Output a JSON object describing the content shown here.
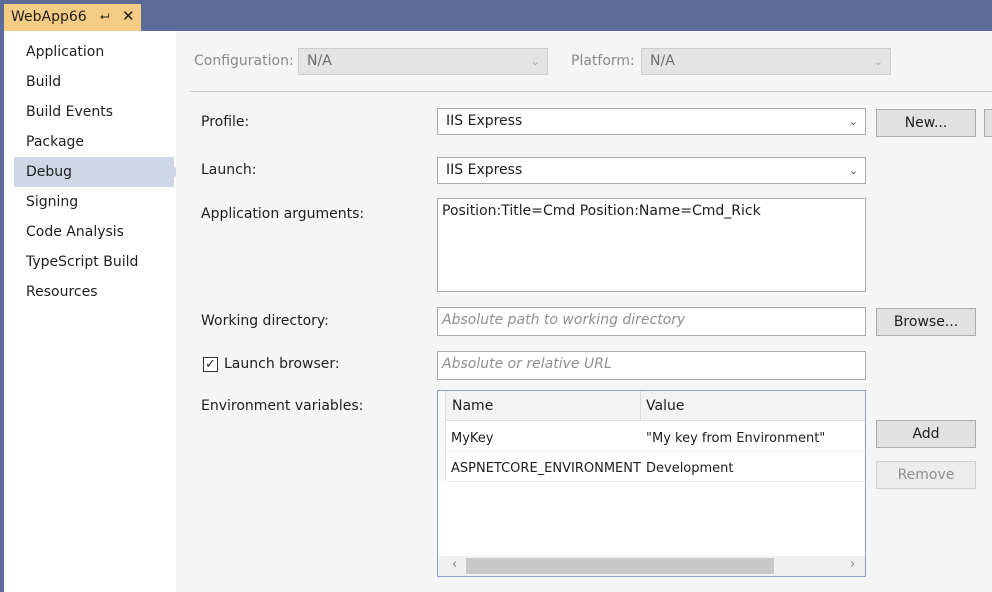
{
  "tab": {
    "title": "WebApp66",
    "pin_glyph": "⮠",
    "close_glyph": "✕"
  },
  "sidebar": {
    "items": [
      {
        "label": "Application"
      },
      {
        "label": "Build"
      },
      {
        "label": "Build Events"
      },
      {
        "label": "Package"
      },
      {
        "label": "Debug",
        "active": true
      },
      {
        "label": "Signing"
      },
      {
        "label": "Code Analysis"
      },
      {
        "label": "TypeScript Build"
      },
      {
        "label": "Resources"
      }
    ]
  },
  "toolbar": {
    "configuration_label": "Configuration:",
    "configuration_value": "N/A",
    "platform_label": "Platform:",
    "platform_value": "N/A"
  },
  "form": {
    "profile_label": "Profile:",
    "profile_value": "IIS Express",
    "new_button": "New...",
    "launch_label": "Launch:",
    "launch_value": "IIS Express",
    "app_args_label": "Application arguments:",
    "app_args_value": "Position:Title=Cmd Position:Name=Cmd_Rick",
    "working_dir_label": "Working directory:",
    "working_dir_placeholder": "Absolute path to working directory",
    "browse_button": "Browse...",
    "launch_browser_label": "Launch browser:",
    "launch_browser_checked": true,
    "launch_browser_placeholder": "Absolute or relative URL",
    "env_label": "Environment variables:",
    "add_button": "Add",
    "remove_button": "Remove"
  },
  "env_table": {
    "columns": [
      "Name",
      "Value"
    ],
    "rows": [
      {
        "name": "MyKey",
        "value": "\"My key from Environment\""
      },
      {
        "name": "ASPNETCORE_ENVIRONMENT",
        "value": "Development"
      }
    ]
  },
  "icons": {
    "caret": "⌄",
    "check": "✓",
    "scroll_left": "‹",
    "scroll_right": "›"
  }
}
